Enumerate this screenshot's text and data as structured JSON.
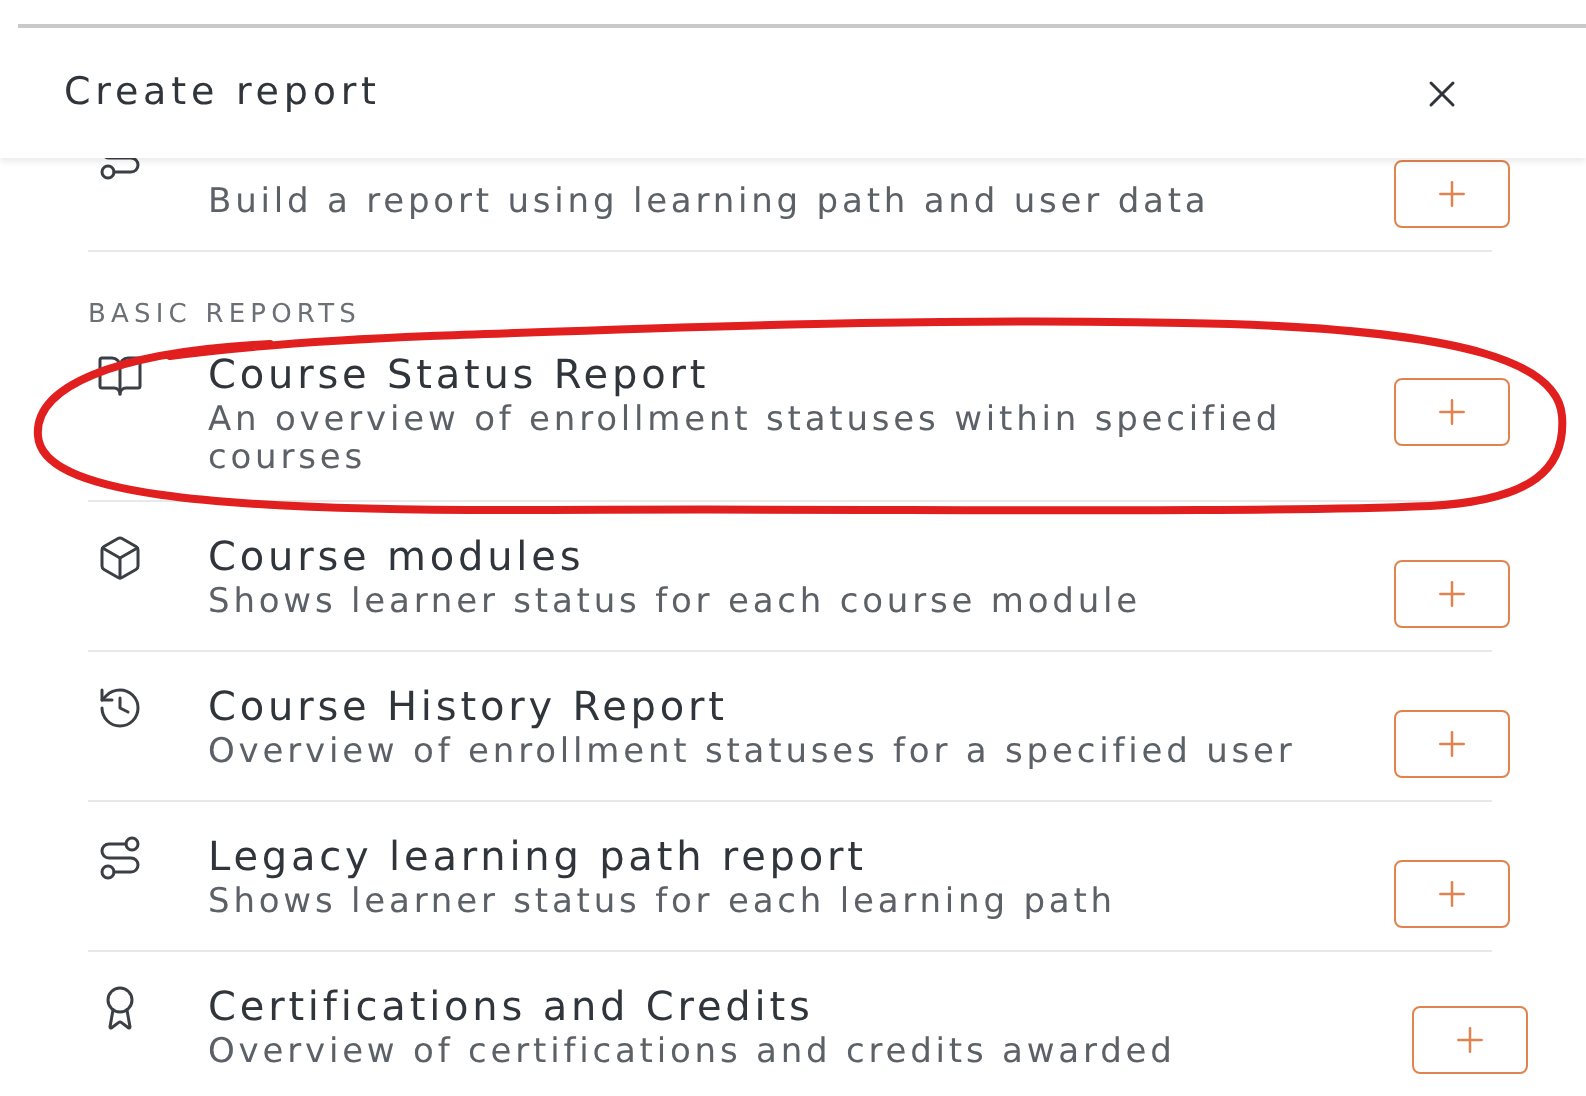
{
  "dialog": {
    "title": "Create report"
  },
  "reports": [
    {
      "description": "Build a report using learning path and user data"
    }
  ],
  "sections": [
    {
      "label": "BASIC REPORTS",
      "items": [
        {
          "title": "Course Status Report",
          "description": "An overview of enrollment statuses within specified courses"
        },
        {
          "title": "Course modules",
          "description": "Shows learner status for each course module"
        },
        {
          "title": "Course History Report",
          "description": "Overview of enrollment statuses for a specified user"
        },
        {
          "title": "Legacy learning path report",
          "description": "Shows learner status for each learning path"
        },
        {
          "title": "Certifications and Credits",
          "description": "Overview of certifications and credits awarded"
        }
      ]
    }
  ]
}
